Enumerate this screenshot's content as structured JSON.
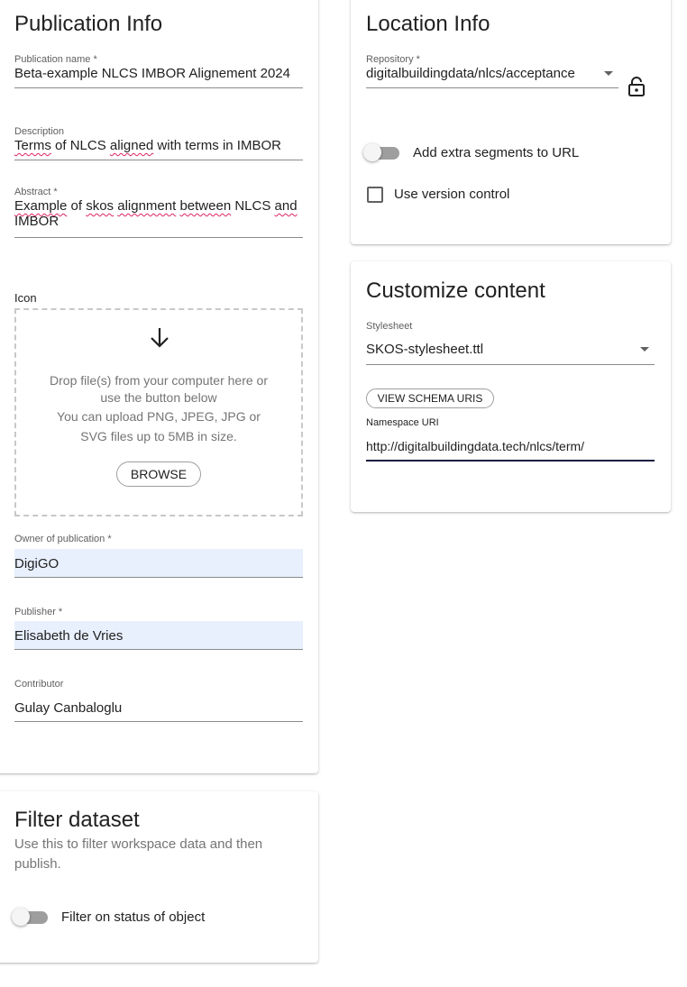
{
  "publication_info": {
    "title": "Publication Info",
    "publication_name": {
      "label": "Publication name *",
      "value": "Beta-example NLCS IMBOR Alignement 2024"
    },
    "description": {
      "label": "Description",
      "value_segments": [
        "Terms",
        " of NLCS ",
        "aligned",
        " with terms in IMBOR"
      ]
    },
    "abstract": {
      "label": "Abstract *",
      "line1_segments": [
        "Example",
        " of ",
        "skos",
        " ",
        "alignment",
        " ",
        "between",
        " NLCS ",
        "and"
      ],
      "line2": "IMBOR"
    },
    "icon": {
      "label": "Icon",
      "arrow_icon": "arrow-down-icon",
      "drop_line1": "Drop file(s) from your computer here or",
      "drop_line2": "use the button below",
      "drop_line3": "You can upload PNG, JPEG, JPG or",
      "drop_line4": "SVG files up to 5MB in size.",
      "browse_label": "BROWSE"
    },
    "owner": {
      "label": "Owner of publication *",
      "value": "DigiGO"
    },
    "publisher": {
      "label": "Publisher *",
      "value": "Elisabeth de Vries"
    },
    "contributor": {
      "label": "Contributor",
      "value": "Gulay Canbaloglu"
    }
  },
  "filter_dataset": {
    "title": "Filter dataset",
    "subtitle_line1": "Use this to filter workspace data and then",
    "subtitle_line2": "publish.",
    "toggle_label": "Filter on status of object",
    "toggle_on": false
  },
  "location_info": {
    "title": "Location Info",
    "repository": {
      "label": "Repository *",
      "value": "digitalbuildingdata/nlcs/acceptance"
    },
    "lock_icon": "lock-open-icon",
    "extra_segments_label": "Add extra segments to URL",
    "extra_segments_on": false,
    "version_control_label": "Use version control",
    "version_control_checked": false
  },
  "customize_content": {
    "title": "Customize content",
    "stylesheet": {
      "label": "Stylesheet",
      "value": "SKOS-stylesheet.ttl"
    },
    "view_schema_label": "VIEW SCHEMA URIS",
    "namespace": {
      "label": "Namespace URI",
      "value": "http://digitalbuildingdata.tech/nlcs/term/"
    }
  },
  "colors": {
    "filled_input": "#e8f0fe",
    "spell_error": "#e0245e",
    "focus_line": "#1a1a40"
  }
}
